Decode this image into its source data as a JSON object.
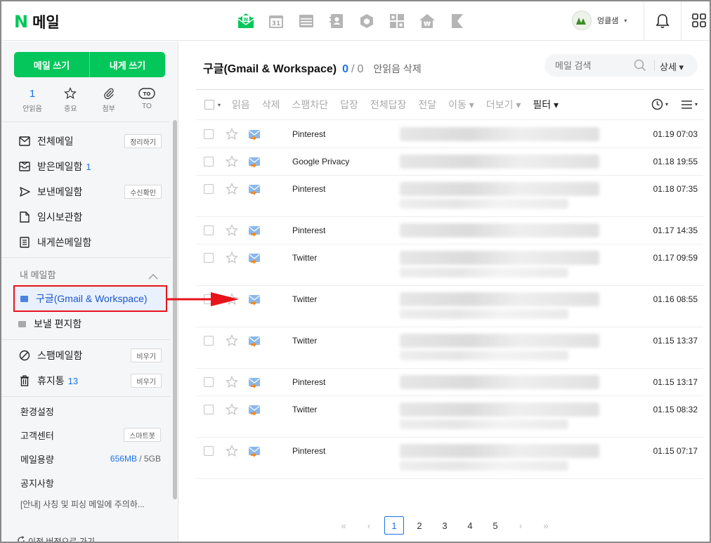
{
  "app": {
    "logo_letter": "N",
    "name": "메일"
  },
  "topbar": {
    "app_icons": [
      "mail-app-icon",
      "calendar-app-icon",
      "contacts-list-icon",
      "address-book-icon",
      "drive-box-icon",
      "memo-grid-icon",
      "pay-home-icon",
      "bookmark-icon"
    ],
    "profile_name": "엉클샘",
    "profile_caret": "▾"
  },
  "sidebar": {
    "compose_label": "메일 쓰기",
    "self_compose_label": "내게 쓰기",
    "quick": [
      {
        "top": "1",
        "label": "안읽음"
      },
      {
        "top": "☆",
        "label": "중요"
      },
      {
        "top": "",
        "label": "첨부"
      },
      {
        "top": "",
        "label": "TO"
      }
    ],
    "quick_to_badge": "TO",
    "mailboxes": [
      {
        "label": "전체메일",
        "count": "",
        "button": "정리하기"
      },
      {
        "label": "받은메일함",
        "count": "1",
        "button": ""
      },
      {
        "label": "보낸메일함",
        "count": "",
        "button": "수신확인"
      },
      {
        "label": "임시보관함",
        "count": "",
        "button": ""
      },
      {
        "label": "내게쓴메일함",
        "count": "",
        "button": ""
      }
    ],
    "my_mailbox_title": "내 메일함",
    "folders": [
      {
        "label": "구글(Gmail & Workspace)"
      },
      {
        "label": "보낼 편지함"
      }
    ],
    "spam_label": "스팸메일함",
    "spam_button": "비우기",
    "trash_label": "휴지통",
    "trash_count": "13",
    "trash_button": "비우기",
    "settings_label": "환경설정",
    "support_label": "고객센터",
    "support_button": "스마트봇",
    "storage_label": "메일용량",
    "storage_used": "656MB",
    "storage_sep": "/",
    "storage_total": "5GB",
    "notice_title": "공지사항",
    "notice_text": "[안내] 사칭 및 피싱 메일에 주의하...",
    "old_version": "이전 버전으로 가기"
  },
  "main": {
    "folder_title": "구글(Gmail & Workspace)",
    "unread_count": "0",
    "slash": "/",
    "total_count": "0",
    "delete_unread": "안읽음 삭제",
    "search_placeholder": "메일 검색",
    "search_detail": "상세 ▾",
    "toolbar": [
      "읽음",
      "삭제",
      "스팸차단",
      "답장",
      "전체답장",
      "전달",
      "이동 ▾",
      "더보기 ▾"
    ],
    "toolbar_filter": "필터 ▾",
    "caret": "▾",
    "rows": [
      {
        "sender": "Pinterest",
        "date": "01.19 07:03",
        "tall": false
      },
      {
        "sender": "Google Privacy",
        "date": "01.18 19:55",
        "tall": false
      },
      {
        "sender": "Pinterest",
        "date": "01.18 07:35",
        "tall": true
      },
      {
        "sender": "Pinterest",
        "date": "01.17 14:35",
        "tall": false
      },
      {
        "sender": "Twitter",
        "date": "01.17 09:59",
        "tall": true
      },
      {
        "sender": "Twitter",
        "date": "01.16 08:55",
        "tall": true
      },
      {
        "sender": "Twitter",
        "date": "01.15 13:37",
        "tall": true
      },
      {
        "sender": "Pinterest",
        "date": "01.15 13:17",
        "tall": false
      },
      {
        "sender": "Twitter",
        "date": "01.15 08:32",
        "tall": true
      },
      {
        "sender": "Pinterest",
        "date": "01.15 07:17",
        "tall": true
      }
    ],
    "pagination": {
      "first": "«",
      "prev": "‹",
      "next": "›",
      "last": "»",
      "pages": [
        "1",
        "2",
        "3",
        "4",
        "5"
      ],
      "current": "1"
    }
  },
  "colors": {
    "brand": "#03c75a",
    "accent": "#1a73e8",
    "highlight_border": "#e8141b",
    "arrow": "#e8141b"
  }
}
